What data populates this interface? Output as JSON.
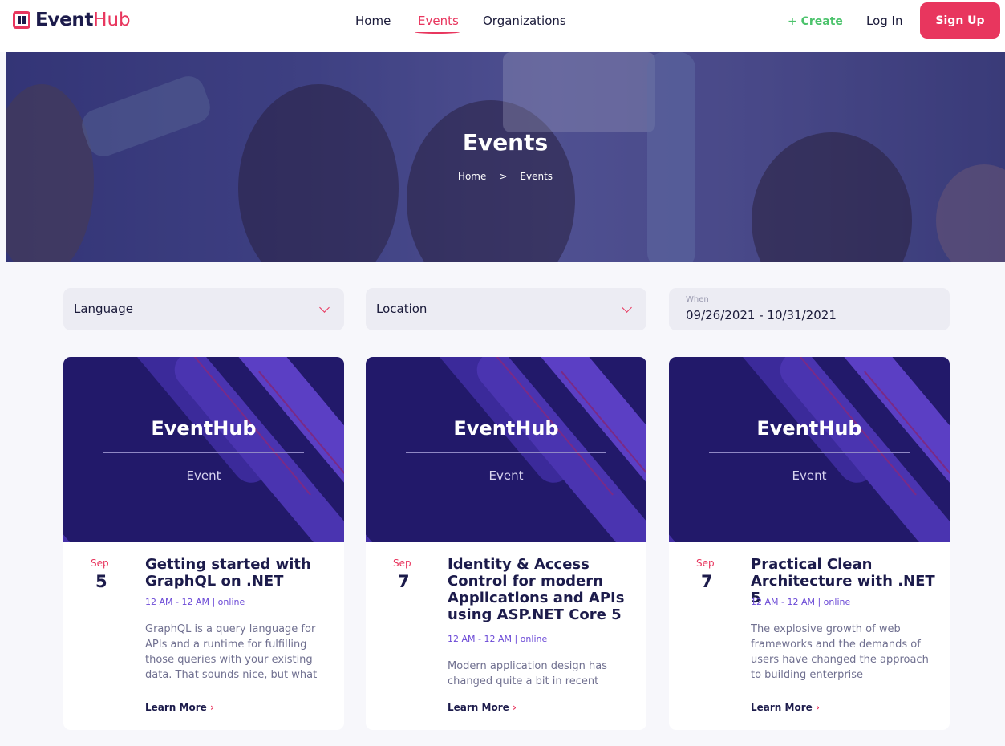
{
  "brand": {
    "bold": "Event",
    "light": "Hub"
  },
  "nav": {
    "home": "Home",
    "events": "Events",
    "organizations": "Organizations",
    "create": "+ Create",
    "login": "Log In",
    "signup": "Sign Up"
  },
  "hero": {
    "title": "Events",
    "breadcrumb": [
      "Home",
      ">",
      "Events"
    ]
  },
  "filters": {
    "language": "Language",
    "location": "Location",
    "when_label": "When",
    "when_value": "09/26/2021 - 10/31/2021"
  },
  "cards": [
    {
      "banner_title": "EventHub",
      "banner_sub": "Event",
      "month": "Sep",
      "day": "5",
      "title": "Getting started with GraphQL on .NET",
      "meta": "12 AM - 12 AM | online",
      "desc": "GraphQL is a query language for APIs and a runtime for fulfilling those queries with your existing data. That sounds nice, but what",
      "learn": "Learn More"
    },
    {
      "banner_title": "EventHub",
      "banner_sub": "Event",
      "month": "Sep",
      "day": "7",
      "title": "Identity & Access Control for modern Applications and APIs using ASP.NET Core 5",
      "meta": "12 AM - 12 AM | online",
      "desc": "Modern application design has changed quite a bit in recent",
      "learn": "Learn More"
    },
    {
      "banner_title": "EventHub",
      "banner_sub": "Event",
      "month": "Sep",
      "day": "7",
      "title": "Practical Clean Architecture with .NET 5",
      "meta": "12 AM - 12 AM | online",
      "desc": "The explosive growth of web frameworks and the demands of users have changed the approach to building enterprise",
      "learn": "Learn More"
    }
  ]
}
